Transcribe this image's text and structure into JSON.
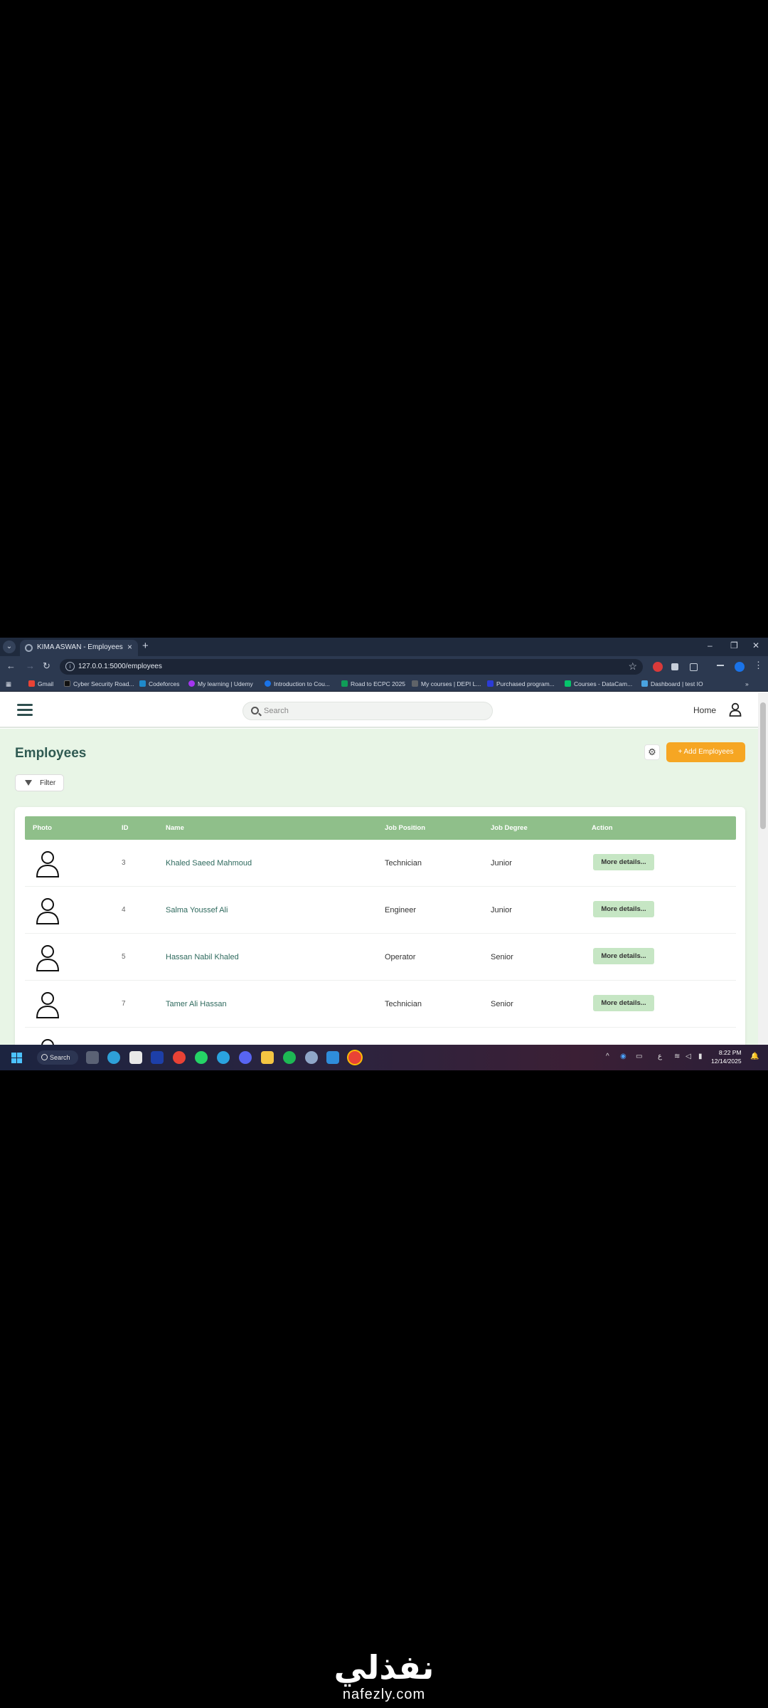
{
  "browser": {
    "tab_title": "KIMA ASWAN - Employees",
    "url": "127.0.0.1:5000/employees",
    "bookmarks": [
      "Gmail",
      "Cyber Security Road...",
      "Codeforces",
      "My learning | Udemy",
      "Introduction to Cou...",
      "Road to ECPC 2025",
      "My courses | DEPI L...",
      "Purchased program...",
      "Courses - DataCam...",
      "Dashboard | test IO"
    ],
    "bookmark_colors": [
      "#ea4335",
      "#111111",
      "#1f8acb",
      "#a435f0",
      "#1a73e8",
      "#0f9d58",
      "#5f6368",
      "#2b3bd6",
      "#05c46b",
      "#4aa3df"
    ]
  },
  "header": {
    "search_placeholder": "Search",
    "home_label": "Home"
  },
  "page": {
    "title": "Employees",
    "add_button": "+ Add Employees",
    "filter_button": "Filter"
  },
  "table": {
    "columns": [
      "Photo",
      "ID",
      "Name",
      "Job Position",
      "Job Degree",
      "Action"
    ],
    "rows": [
      {
        "id": "3",
        "name": "Khaled Saeed Mahmoud",
        "position": "Technician",
        "degree": "Junior",
        "action": "More details..."
      },
      {
        "id": "4",
        "name": "Salma Youssef Ali",
        "position": "Engineer",
        "degree": "Junior",
        "action": "More details..."
      },
      {
        "id": "5",
        "name": "Hassan Nabil Khaled",
        "position": "Operator",
        "degree": "Senior",
        "action": "More details..."
      },
      {
        "id": "7",
        "name": "Tamer Ali Hassan",
        "position": "Technician",
        "degree": "Senior",
        "action": "More details..."
      }
    ]
  },
  "taskbar": {
    "search_label": "Search",
    "time": "8:22 PM",
    "date": "12/14/2025"
  },
  "watermark": {
    "arabic": "نفذلي",
    "latin": "nafezly.com"
  },
  "colors": {
    "accent": "#f6a623",
    "table_header": "#8fbf8a",
    "page_bg": "#e8f5e6",
    "title": "#2f5a52"
  }
}
